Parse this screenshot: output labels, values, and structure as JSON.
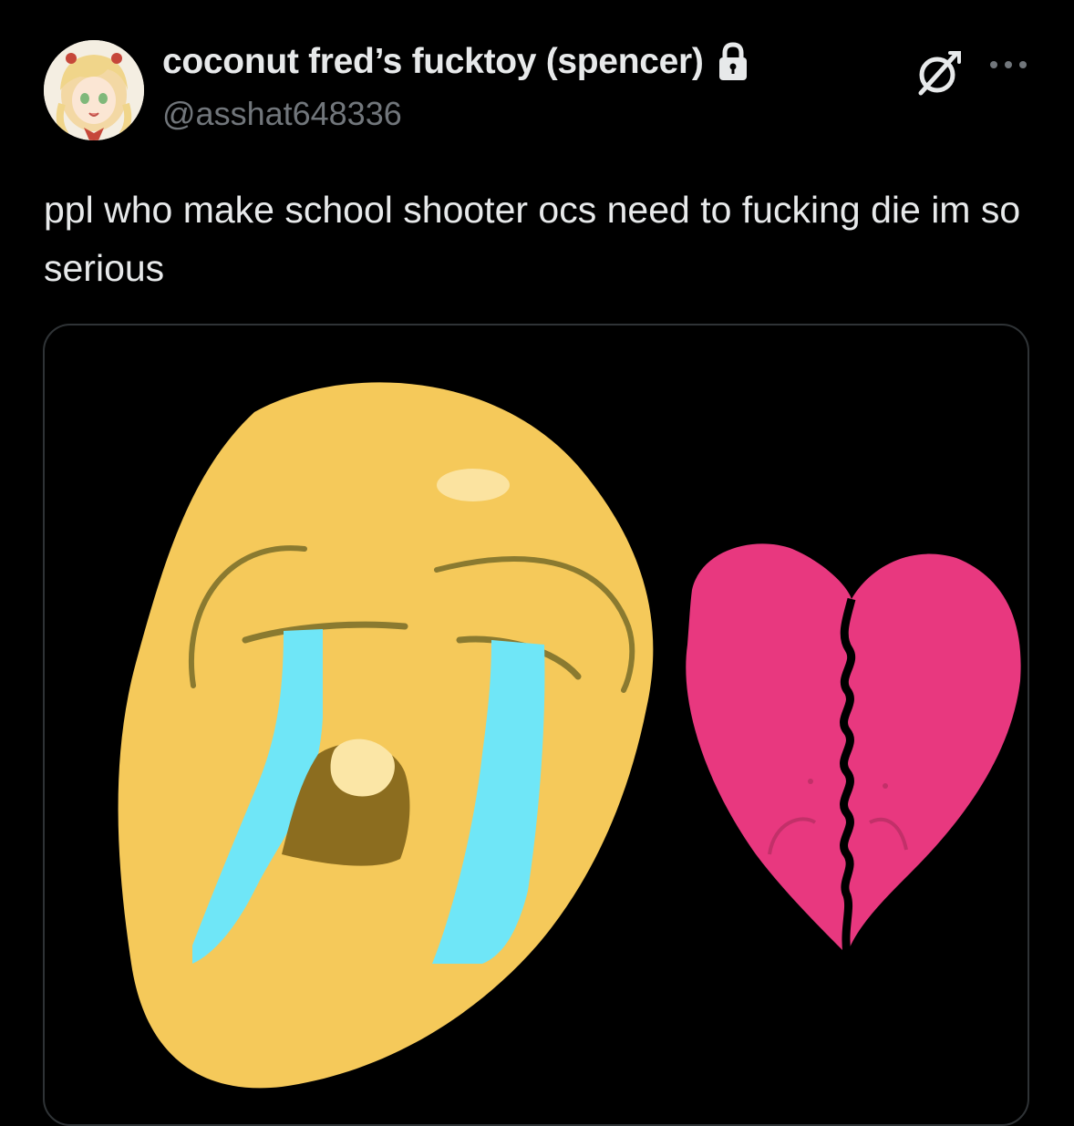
{
  "post": {
    "author": {
      "display_name": "coconut fred’s fucktoy (spencer)",
      "handle": "@asshat648336",
      "protected_icon": "lock-icon",
      "avatar": "anime-girl-avatar"
    },
    "actions": {
      "grok_icon": "grok-icon",
      "more_icon": "more-dots-icon"
    },
    "text": "ppl who make school shooter ocs need to fucking die im so serious",
    "media": {
      "image": "crying-face-and-broken-heart-drawing",
      "colors": {
        "face": "#f5c95a",
        "tears": "#6fe6f7",
        "heart": "#e8387f",
        "crack": "#000000"
      }
    }
  },
  "theme": {
    "background": "#000000",
    "text_primary": "#e7e9ea",
    "text_secondary": "#71767b",
    "border": "#2f3336"
  }
}
